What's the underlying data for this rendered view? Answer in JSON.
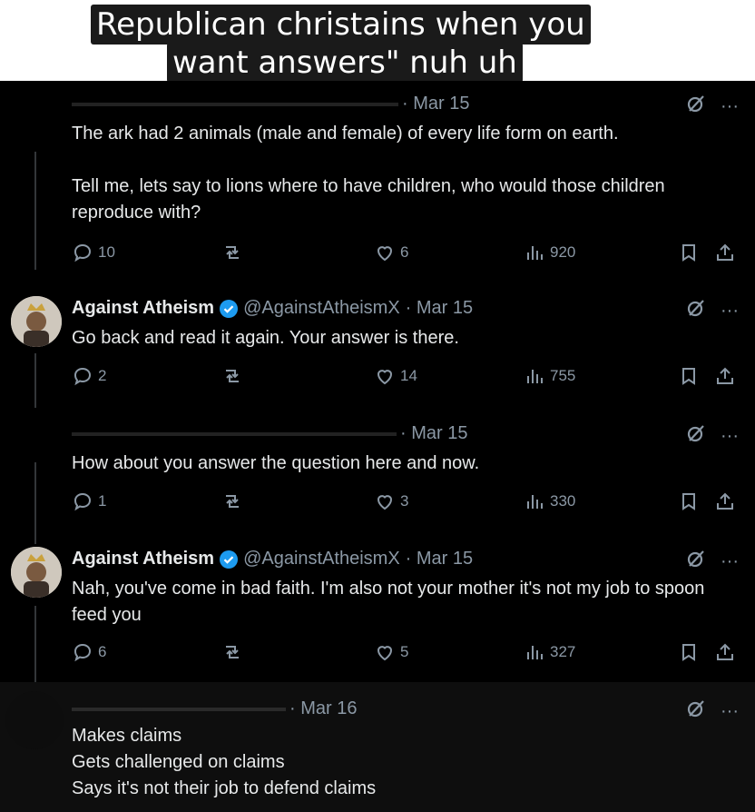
{
  "caption": {
    "line1": "Republican christains when you",
    "line2": "want  answers\" nuh uh"
  },
  "tweets": [
    {
      "name": "",
      "handle": "",
      "date": "· Mar 15",
      "lines": [
        "The ark had 2 animals (male and female) of every life form on earth.",
        "",
        "Tell me, lets say to lions where to have children, who would those children reproduce with?"
      ],
      "replies": "10",
      "reposts": "",
      "likes": "6",
      "views": "920"
    },
    {
      "name": "Against Atheism",
      "handle": "@AgainstAtheismX",
      "date": "· Mar 15",
      "lines": [
        "Go back and read it again. Your answer is there."
      ],
      "replies": "2",
      "reposts": "",
      "likes": "14",
      "views": "755"
    },
    {
      "name": "",
      "handle": "",
      "date": "· Mar 15",
      "lines": [
        "How about you answer the question here and now."
      ],
      "replies": "1",
      "reposts": "",
      "likes": "3",
      "views": "330"
    },
    {
      "name": "Against Atheism",
      "handle": "@AgainstAtheismX",
      "date": "· Mar 15",
      "lines": [
        "Nah, you've come in bad faith. I'm also not your mother it's not my job to spoon feed you"
      ],
      "replies": "6",
      "reposts": "",
      "likes": "5",
      "views": "327"
    },
    {
      "name": "",
      "handle": "",
      "date": "· Mar 16",
      "lines": [
        "Makes claims",
        "Gets challenged on claims",
        "Says it's not their job to defend claims"
      ]
    }
  ],
  "icons": {
    "grok": "grok-icon",
    "more": "more-icon",
    "reply": "reply-icon",
    "repost": "repost-icon",
    "like": "like-icon",
    "views": "views-icon",
    "bookmark": "bookmark-icon",
    "share": "share-icon",
    "verified": "verified-badge-icon"
  },
  "colors": {
    "background": "#000000",
    "text": "#e7e9ea",
    "muted": "#8b98a5",
    "verified": "#1d9bf0"
  }
}
